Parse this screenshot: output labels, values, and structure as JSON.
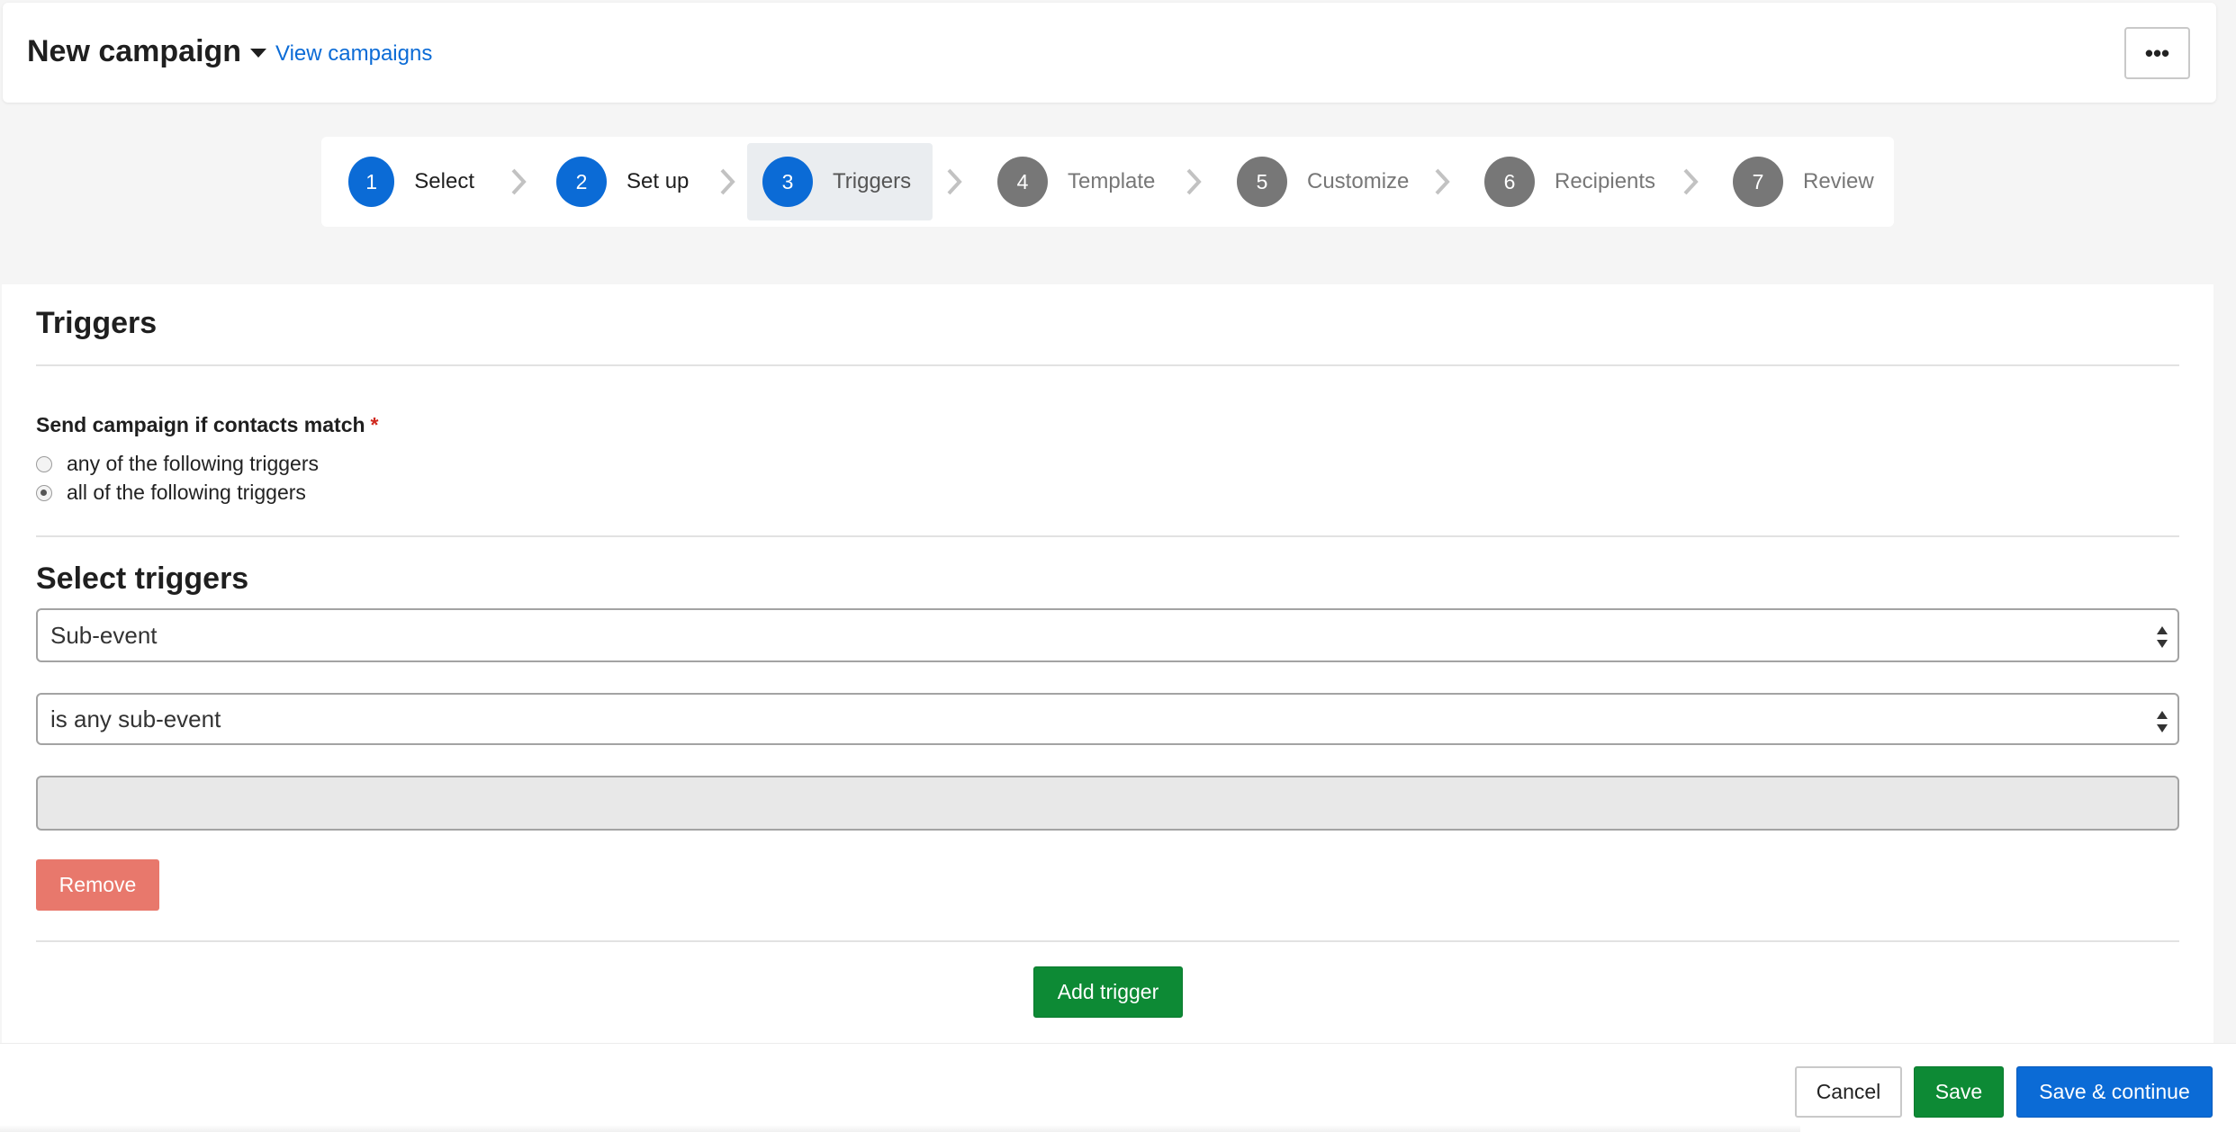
{
  "header": {
    "title": "New campaign",
    "view_link": "View campaigns",
    "more_label": "•••"
  },
  "stepper": {
    "steps": [
      {
        "num": "1",
        "label": "Select",
        "state": "complete"
      },
      {
        "num": "2",
        "label": "Set up",
        "state": "complete"
      },
      {
        "num": "3",
        "label": "Triggers",
        "state": "active"
      },
      {
        "num": "4",
        "label": "Template",
        "state": "pending"
      },
      {
        "num": "5",
        "label": "Customize",
        "state": "pending"
      },
      {
        "num": "6",
        "label": "Recipients",
        "state": "pending"
      },
      {
        "num": "7",
        "label": "Review",
        "state": "pending"
      }
    ],
    "colors": {
      "complete": "#0b6bd6",
      "pending": "#777777",
      "active_bg": "#eaedf0"
    }
  },
  "main": {
    "title": "Triggers",
    "match_label": "Send campaign if contacts match",
    "required_mark": "*",
    "options": [
      {
        "label": "any of the following triggers",
        "checked": false
      },
      {
        "label": "all of the following triggers",
        "checked": true
      }
    ],
    "select_title": "Select triggers",
    "trigger_type": "Sub-event",
    "trigger_condition": "is any sub-event",
    "trigger_value": "",
    "remove_label": "Remove",
    "add_label": "Add trigger"
  },
  "footer": {
    "cancel_label": "Cancel",
    "save_label": "Save",
    "save_continue_label": "Save & continue"
  }
}
